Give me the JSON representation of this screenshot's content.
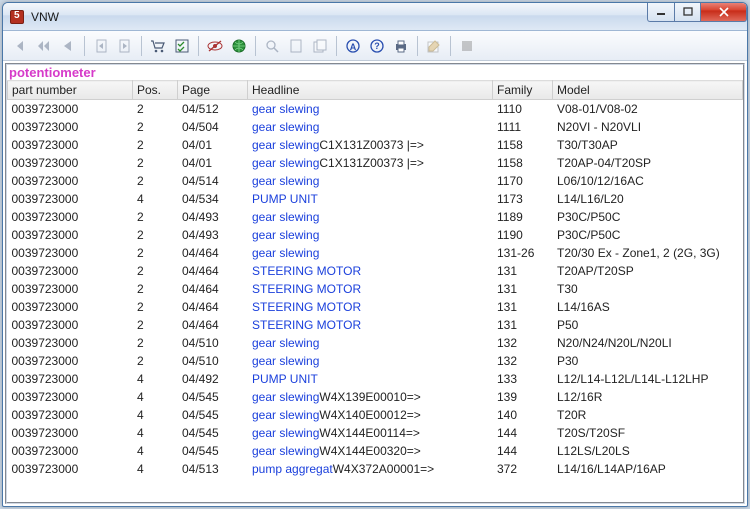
{
  "window": {
    "title": "VNW"
  },
  "search_term": "potentiometer",
  "columns": {
    "part": "part number",
    "pos": "Pos.",
    "page": "Page",
    "headline": "Headline",
    "family": "Family",
    "model": "Model"
  },
  "rows": [
    {
      "part": "0039723000",
      "pos": "2",
      "page": "04/512",
      "head_link": "gear slewing",
      "head_suffix": "",
      "family": "1110",
      "model": "V08-01/V08-02"
    },
    {
      "part": "0039723000",
      "pos": "2",
      "page": "04/504",
      "head_link": "gear slewing",
      "head_suffix": "",
      "family": "1111",
      "model": "N20VI - N20VLI"
    },
    {
      "part": "0039723000",
      "pos": "2",
      "page": "04/01",
      "head_link": "gear slewing",
      "head_suffix": "C1X131Z00373 |=>",
      "family": "1158",
      "model": "T30/T30AP"
    },
    {
      "part": "0039723000",
      "pos": "2",
      "page": "04/01",
      "head_link": "gear slewing",
      "head_suffix": "C1X131Z00373 |=>",
      "family": "1158",
      "model": "T20AP-04/T20SP"
    },
    {
      "part": "0039723000",
      "pos": "2",
      "page": "04/514",
      "head_link": "gear slewing",
      "head_suffix": "",
      "family": "1170",
      "model": "L06/10/12/16AC"
    },
    {
      "part": "0039723000",
      "pos": "4",
      "page": "04/534",
      "head_link": "PUMP UNIT",
      "head_suffix": "",
      "family": "1173",
      "model": "L14/L16/L20"
    },
    {
      "part": "0039723000",
      "pos": "2",
      "page": "04/493",
      "head_link": "gear slewing",
      "head_suffix": "",
      "family": "1189",
      "model": "P30C/P50C"
    },
    {
      "part": "0039723000",
      "pos": "2",
      "page": "04/493",
      "head_link": "gear slewing",
      "head_suffix": "",
      "family": "1190",
      "model": "P30C/P50C"
    },
    {
      "part": "0039723000",
      "pos": "2",
      "page": "04/464",
      "head_link": "gear slewing",
      "head_suffix": "",
      "family": "131-26",
      "model": "T20/30 Ex - Zone1, 2 (2G, 3G)"
    },
    {
      "part": "0039723000",
      "pos": "2",
      "page": "04/464",
      "head_link": "STEERING MOTOR",
      "head_suffix": "",
      "family": "131",
      "model": "T20AP/T20SP"
    },
    {
      "part": "0039723000",
      "pos": "2",
      "page": "04/464",
      "head_link": "STEERING MOTOR",
      "head_suffix": "",
      "family": "131",
      "model": "T30"
    },
    {
      "part": "0039723000",
      "pos": "2",
      "page": "04/464",
      "head_link": "STEERING MOTOR",
      "head_suffix": "",
      "family": "131",
      "model": "L14/16AS"
    },
    {
      "part": "0039723000",
      "pos": "2",
      "page": "04/464",
      "head_link": "STEERING MOTOR",
      "head_suffix": "",
      "family": "131",
      "model": "P50"
    },
    {
      "part": "0039723000",
      "pos": "2",
      "page": "04/510",
      "head_link": "gear slewing",
      "head_suffix": "",
      "family": "132",
      "model": "N20/N24/N20L/N20LI"
    },
    {
      "part": "0039723000",
      "pos": "2",
      "page": "04/510",
      "head_link": "gear slewing",
      "head_suffix": "",
      "family": "132",
      "model": "P30"
    },
    {
      "part": "0039723000",
      "pos": "4",
      "page": "04/492",
      "head_link": "PUMP UNIT",
      "head_suffix": "",
      "family": "133",
      "model": "L12/L14-L12L/L14L-L12LHP"
    },
    {
      "part": "0039723000",
      "pos": "4",
      "page": "04/545",
      "head_link": "gear slewing",
      "head_suffix": "W4X139E00010=>",
      "family": "139",
      "model": "L12/16R"
    },
    {
      "part": "0039723000",
      "pos": "4",
      "page": "04/545",
      "head_link": "gear slewing",
      "head_suffix": "W4X140E00012=>",
      "family": "140",
      "model": "T20R"
    },
    {
      "part": "0039723000",
      "pos": "4",
      "page": "04/545",
      "head_link": "gear slewing",
      "head_suffix": "W4X144E00114=>",
      "family": "144",
      "model": "T20S/T20SF"
    },
    {
      "part": "0039723000",
      "pos": "4",
      "page": "04/545",
      "head_link": "gear slewing",
      "head_suffix": "W4X144E00320=>",
      "family": "144",
      "model": "L12LS/L20LS"
    },
    {
      "part": "0039723000",
      "pos": "4",
      "page": "04/513",
      "head_link": "pump aggregat",
      "head_suffix": "W4X372A00001=>",
      "family": "372",
      "model": "L14/16/L14AP/16AP"
    }
  ],
  "toolbar_icons": [
    "nav-first-icon",
    "nav-prev-fast-icon",
    "nav-prev-icon",
    "sep",
    "doc-prev-icon",
    "doc-next-icon",
    "sep",
    "cart-icon",
    "checklist-icon",
    "sep",
    "eye-off-icon",
    "globe-icon",
    "sep",
    "zoom-icon",
    "page-icon",
    "page-dup-icon",
    "sep",
    "info-a-icon",
    "info-q-icon",
    "print-icon",
    "sep",
    "compose-icon",
    "sep",
    "stop-icon"
  ]
}
